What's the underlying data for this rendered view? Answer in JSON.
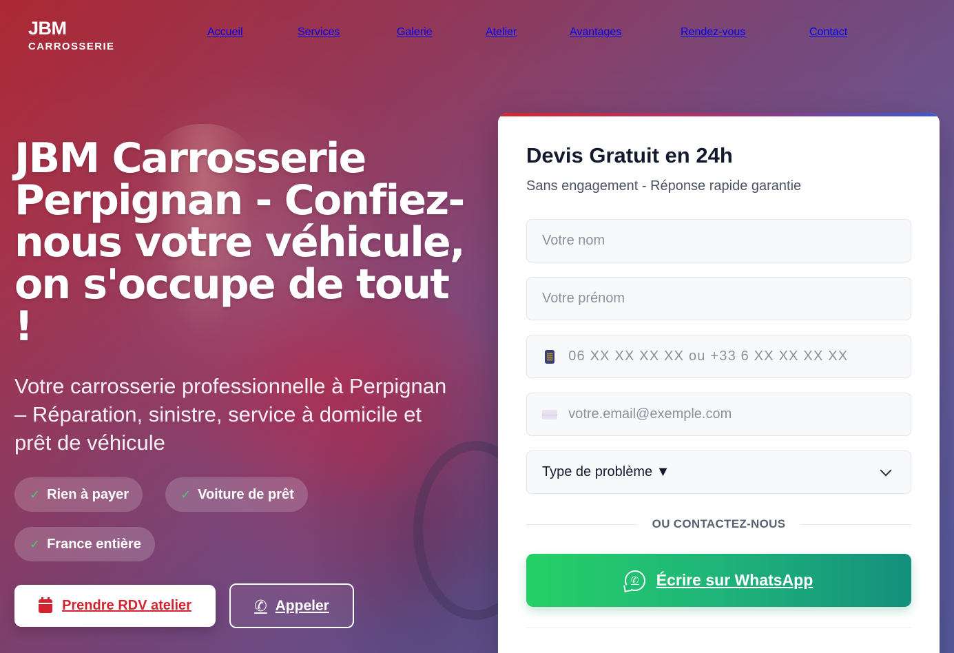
{
  "header": {
    "logo": {
      "main": "JBM",
      "sub": "CARROSSERIE"
    },
    "nav": [
      {
        "label": "Accueil"
      },
      {
        "label": "Services"
      },
      {
        "label": "Galerie"
      },
      {
        "label": "Atelier"
      },
      {
        "label": "Avantages"
      },
      {
        "label": "Rendez-vous"
      },
      {
        "label": "Contact"
      }
    ]
  },
  "hero": {
    "title": "JBM Carrosserie Perpignan - Confiez-nous votre véhicule, on s'occupe de tout !",
    "subtitle": "Votre carrosserie professionnelle à Perpignan – Réparation, sinistre, service à domicile et prêt de véhicule",
    "badges": [
      {
        "label": "Rien à payer",
        "icon": "check-icon"
      },
      {
        "label": "Voiture de prêt",
        "icon": "check-icon"
      },
      {
        "label": "France entière",
        "icon": "check-icon"
      }
    ],
    "buttons": {
      "rdv": {
        "label": "Prendre RDV atelier",
        "icon": "calendar-icon"
      },
      "call": {
        "label": "Appeler",
        "icon": "phone-icon"
      }
    }
  },
  "form": {
    "title": "Devis Gratuit en 24h",
    "subtitle": "Sans engagement - Réponse rapide garantie",
    "fields": {
      "nom": {
        "placeholder": "Votre nom",
        "value": ""
      },
      "prenom": {
        "placeholder": "Votre prénom",
        "value": ""
      },
      "phone": {
        "placeholder": "06 XX XX XX XX ou +33 6 XX XX XX XX",
        "value": "",
        "icon": "mobile-phone-icon"
      },
      "email": {
        "placeholder": "votre.email@exemple.com",
        "value": "",
        "icon": "envelope-icon"
      },
      "type": {
        "selected": "Type de problème ▼"
      }
    },
    "divider": "OU CONTACTEZ-NOUS",
    "whatsapp": {
      "label": "Écrire sur WhatsApp",
      "icon": "whatsapp-icon"
    }
  },
  "colors": {
    "brand_red": "#d3232f",
    "whatsapp_green": "#25d066",
    "card_accent": "#3a5bd0"
  }
}
